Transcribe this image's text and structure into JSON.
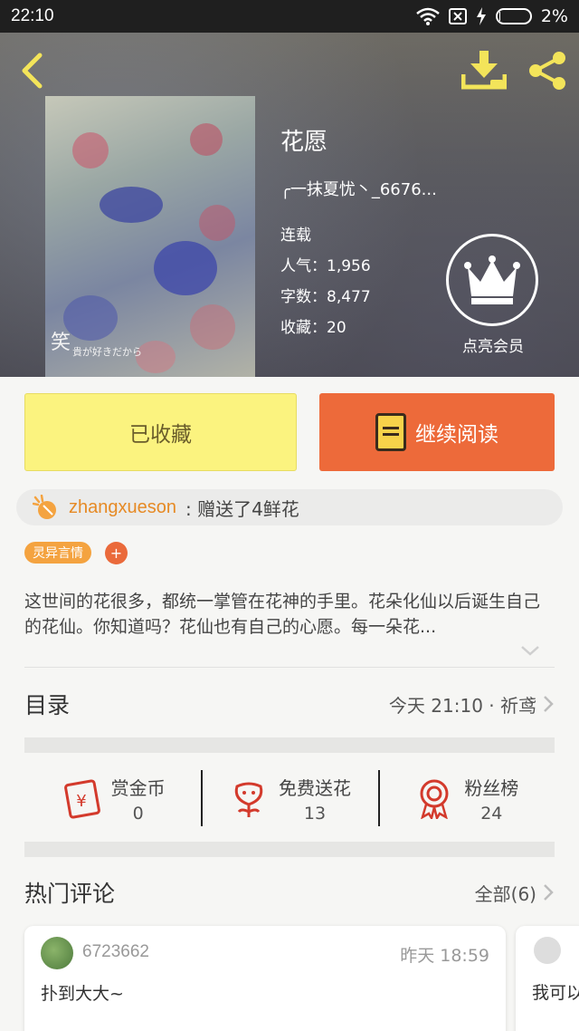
{
  "status_bar": {
    "time": "22:10",
    "battery": "2%",
    "battery_level": 0.02
  },
  "book": {
    "title": "花愿",
    "author": "╭一抹夏忧丶_6676...",
    "status": "连载",
    "popularity": "人气：1,956",
    "words": "字数：8,477",
    "favorites": "收藏：20",
    "cover_text": "笑",
    "cover_sub": "貴が好きだから"
  },
  "vip": {
    "label": "点亮会员"
  },
  "actions": {
    "collected": "已收藏",
    "continue_reading": "继续阅读"
  },
  "gift": {
    "user": "zhangxueson",
    "text": ": 赠送了4鲜花"
  },
  "tags": {
    "genre": "灵异言情",
    "add": "+"
  },
  "description": "这世间的花很多，都统一掌管在花神的手里。花朵化仙以后诞生自己的花仙。你知道吗？花仙也有自己的心愿。每一朵花...",
  "toc": {
    "label": "目录",
    "latest": "今天 21:10 · 祈鸢"
  },
  "stats": [
    {
      "label": "赏金币",
      "value": "0"
    },
    {
      "label": "免费送花",
      "value": "13"
    },
    {
      "label": "粉丝榜",
      "value": "24"
    }
  ],
  "comments": {
    "label": "热门评论",
    "all": "全部(6)",
    "items": [
      {
        "user": "6723662",
        "time": "昨天 18:59",
        "text": "扑到大大~"
      },
      {
        "user": "",
        "time": "",
        "text": "我可以"
      }
    ]
  },
  "colors": {
    "accent_orange": "#ed6a3a",
    "collected_yellow": "#fbf37f",
    "icon_yellow": "#f3e45a",
    "stat_red": "#d33a2c"
  }
}
